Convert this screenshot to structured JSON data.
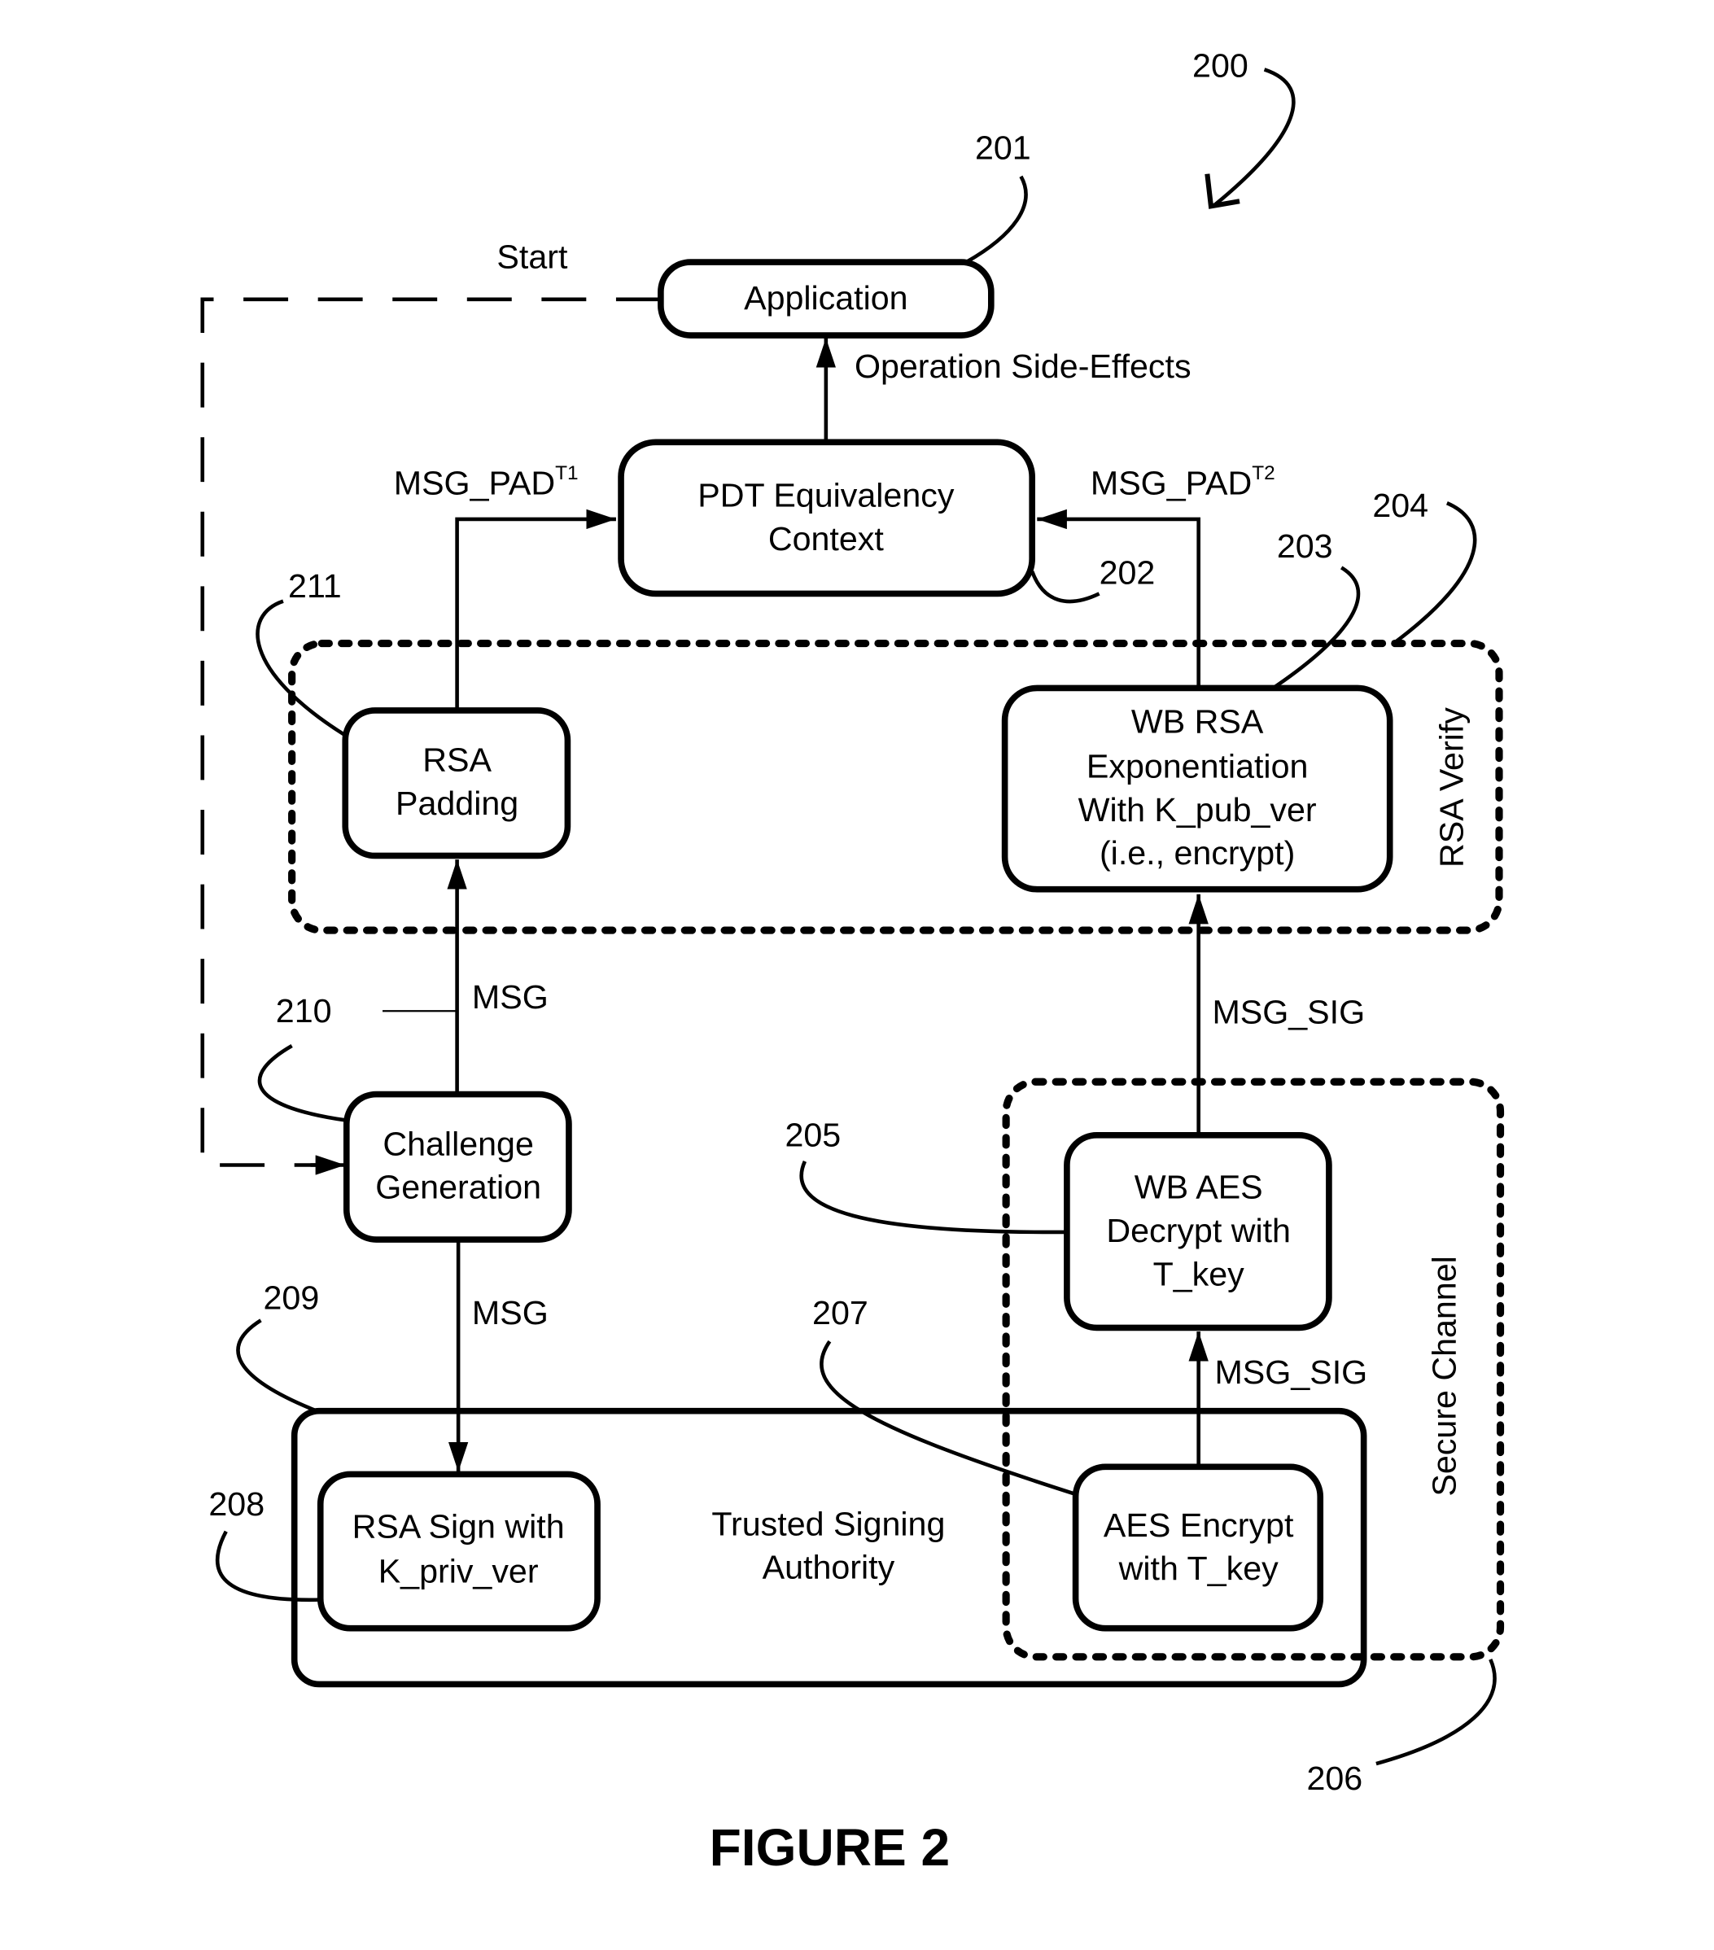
{
  "figure": {
    "caption": "FIGURE 2",
    "ref_overall": "200"
  },
  "nodes": {
    "application": {
      "ref": "201",
      "lines": [
        "Application"
      ]
    },
    "pdt_context": {
      "ref": "202",
      "lines": [
        "PDT Equivalency",
        "Context"
      ]
    },
    "wb_rsa": {
      "ref": "203",
      "lines": [
        "WB RSA",
        "Exponentiation",
        "With K_pub_ver",
        "(i.e., encrypt)"
      ]
    },
    "wb_aes": {
      "ref": "205",
      "lines": [
        "WB AES",
        "Decrypt with",
        "T_key"
      ]
    },
    "aes_encrypt": {
      "ref": "207",
      "lines": [
        "AES Encrypt",
        "with T_key"
      ]
    },
    "rsa_sign": {
      "ref": "208",
      "lines": [
        "RSA Sign with",
        "K_priv_ver"
      ]
    },
    "challenge_gen": {
      "ref": "210",
      "lines": [
        "Challenge",
        "Generation"
      ]
    },
    "rsa_padding": {
      "ref": "211",
      "lines": [
        "RSA",
        "Padding"
      ]
    }
  },
  "groups": {
    "rsa_verify": {
      "ref": "204",
      "label": "RSA Verify"
    },
    "secure_channel": {
      "ref": "206",
      "label": "Secure Channel"
    },
    "trusted_signing": {
      "ref": "209",
      "lines": [
        "Trusted Signing",
        "Authority"
      ]
    }
  },
  "edges": {
    "start": "Start",
    "side_effects": "Operation Side-Effects",
    "msg_pad_t1": {
      "base": "MSG_PAD",
      "sup": "T1"
    },
    "msg_pad_t2": {
      "base": "MSG_PAD",
      "sup": "T2"
    },
    "msg_up": "MSG",
    "msg_down": "MSG",
    "msg_sig_upper": "MSG_SIG",
    "msg_sig_lower": "MSG_SIG"
  }
}
